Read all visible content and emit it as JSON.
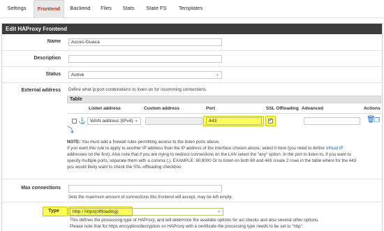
{
  "tabs": [
    {
      "label": "Settings"
    },
    {
      "label": "Frontend"
    },
    {
      "label": "Backend"
    },
    {
      "label": "Files"
    },
    {
      "label": "Stats"
    },
    {
      "label": "State FS"
    },
    {
      "label": "Templates"
    }
  ],
  "panel_title": "Edit HAProxy Frontend",
  "fields": {
    "name": {
      "label": "Name",
      "value": "Acces-Guaca"
    },
    "description": {
      "label": "Description",
      "value": ""
    },
    "status": {
      "label": "Status",
      "value": "Active"
    },
    "external_address": {
      "label": "External address",
      "intro": "Define what ip:port combinations to listen on for incomming connections.",
      "table_title": "Table",
      "columns": [
        "Listen address",
        "Custom address",
        "Port",
        "SSL Offloading",
        "Advanced",
        "Actions"
      ],
      "row": {
        "listen_address": "WAN address (IPv4)",
        "custom_address": "",
        "port": "443",
        "ssl_offloading": true,
        "advanced": ""
      },
      "note_bold": "NOTE:",
      "note": [
        " You must add a firewall rules permitting access to the listen ports above.",
        "If you want this rule to apply to another IP address than the IP address of the interface chosen above, select it here (you need to define ",
        "Virtual IP",
        "addresses on the first). Also note that if you are trying to redirect connections on the LAN select the \"any\" option. In the port to listen to, if you want to",
        "specify multiple ports, separate them with a comma (,). EXAMPLE: 80,8000 Or to listen on both 80 and 443 create 2 rows in the table where for the 443",
        "you would likely want to check the SSL-offloading checkbox."
      ]
    },
    "max_connections": {
      "label": "Max connections",
      "value": "",
      "help": "Sets the maximum amount of connections this frontend will accept, may be left empty."
    },
    "type": {
      "label": "Type",
      "value": "http / https(offloading)",
      "help": [
        "This defines the processing type of HAProxy, and will determine the availabe options for acl checks and also several other options.",
        "Please note that for https encryption/decryption on HAProxy with a certificate the processing type needs to be set to \"http\"."
      ]
    }
  },
  "icons": {
    "anchor": "anchor-icon",
    "delete": "trash-icon",
    "copy": "copy-icon",
    "add_row": "add-row-icon",
    "dropdown": "chevron-down-icon"
  },
  "colors": {
    "active_tab_text": "#c0392b",
    "header_bg": "#3d3d3d",
    "highlight": "#fdfd55",
    "link": "#2266aa"
  }
}
